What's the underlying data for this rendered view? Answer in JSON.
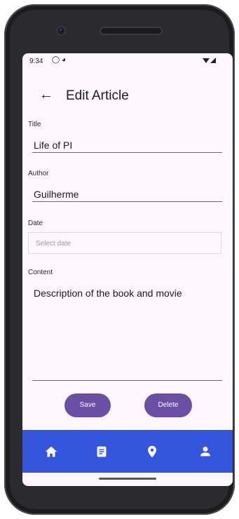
{
  "status_bar": {
    "time": "9:34"
  },
  "appbar": {
    "back_icon": "arrow-left-icon",
    "title": "Edit Article"
  },
  "form": {
    "title_label": "Title",
    "title_value": "Life of PI",
    "author_label": "Author",
    "author_value": "Guilherme",
    "date_label": "Date",
    "date_placeholder": "Select date",
    "content_label": "Content",
    "content_value": "Description of the book and movie"
  },
  "actions": {
    "save_label": "Save",
    "delete_label": "Delete"
  },
  "bottom_nav": {
    "items": [
      "home-icon",
      "article-icon",
      "location-pin-icon",
      "person-icon"
    ]
  },
  "colors": {
    "accent": "#6a4fa5",
    "nav_bar": "#3655dd",
    "background": "#fdf6fc"
  }
}
